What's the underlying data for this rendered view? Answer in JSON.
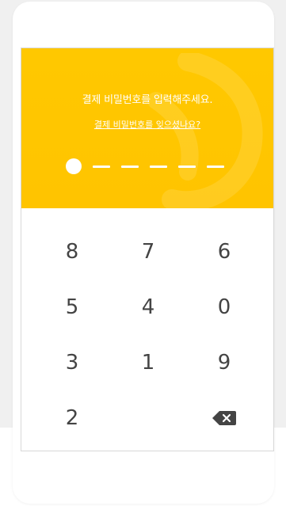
{
  "header": {
    "prompt": "결제 비밀번호를 입력해주세요.",
    "forgot_link": "결제 비밀번호를 잊으셨나요?"
  },
  "pin": {
    "length": 6,
    "entered": 1
  },
  "keypad": {
    "keys": [
      {
        "label": "8"
      },
      {
        "label": "7"
      },
      {
        "label": "6"
      },
      {
        "label": "5"
      },
      {
        "label": "4"
      },
      {
        "label": "0"
      },
      {
        "label": "3"
      },
      {
        "label": "1"
      },
      {
        "label": "9"
      },
      {
        "label": "2"
      },
      {
        "label": ""
      },
      {
        "label": "",
        "icon": "backspace-icon"
      }
    ]
  },
  "colors": {
    "accent": "#ffc800",
    "key_text": "#444444"
  }
}
